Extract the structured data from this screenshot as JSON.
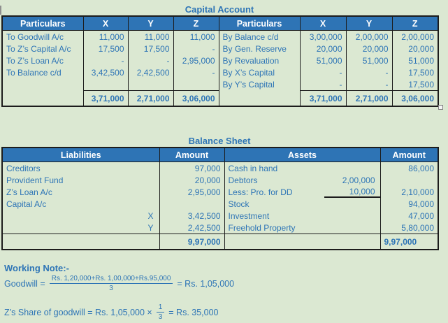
{
  "page": {
    "background_color": "#dbe8d2",
    "accent_color": "#2e75b6",
    "table_header_fill": "#2e74b5",
    "table_header_text_color": "#ffffff",
    "border_color": "#1c1c1c"
  },
  "capital_account": {
    "title": "Capital Account",
    "headers": [
      "Particulars",
      "X",
      "Y",
      "Z",
      "Particulars",
      "X",
      "Y",
      "Z"
    ],
    "rows": [
      [
        "To Goodwill A/c",
        "11,000",
        "11,000",
        "11,000",
        "By Balance c/d",
        "3,00,000",
        "2,00,000",
        "2,00,000"
      ],
      [
        "To Z’s Capital A/c",
        "17,500",
        "17,500",
        "-",
        "By Gen. Reserve",
        "20,000",
        "20,000",
        "20,000"
      ],
      [
        "To Z’s Loan A/c",
        "-",
        "-",
        "2,95,000",
        "By Revaluation",
        "51,000",
        "51,000",
        "51,000"
      ],
      [
        "To Balance c/d",
        "3,42,500",
        "2,42,500",
        "-",
        "By X’s Capital",
        "-",
        "-",
        "17,500"
      ],
      [
        "",
        "",
        "",
        "",
        "By Y’s Capital",
        "-",
        "-",
        "17,500"
      ]
    ],
    "totals": [
      "",
      "3,71,000",
      "2,71,000",
      "3,06,000",
      "",
      "3,71,000",
      "2,71,000",
      "3,06,000"
    ]
  },
  "balance_sheet": {
    "title": "Balance Sheet",
    "headers": [
      "Liabilities",
      "Amount",
      "Assets",
      "Amount"
    ],
    "liability_rows": [
      {
        "label": "Creditors",
        "amount": "97,000"
      },
      {
        "label": "Provident Fund",
        "amount": "20,000"
      },
      {
        "label": "Z’s Loan A/c",
        "amount": "2,95,000"
      },
      {
        "label": "Capital A/c",
        "amount": ""
      },
      {
        "label": "X",
        "amount": "3,42,500"
      },
      {
        "label": "Y",
        "amount": "2,42,500"
      }
    ],
    "asset_rows": [
      {
        "label": "Cash in hand",
        "sub": "",
        "amount": "86,000"
      },
      {
        "label": "Debtors",
        "sub": "2,00,000",
        "amount": ""
      },
      {
        "label": "Less: Pro. for DD",
        "sub": "10,000",
        "amount": "2,10,000"
      },
      {
        "label": "Stock",
        "sub": "",
        "amount": "94,000"
      },
      {
        "label": "Investment",
        "sub": "",
        "amount": "47,000"
      },
      {
        "label": "Freehold Property",
        "sub": "",
        "amount": "5,80,000"
      }
    ],
    "total_left": "9,97,000",
    "total_right": "9,97,000"
  },
  "working_note": {
    "heading": "Working Note:-",
    "goodwill_prefix": "Goodwill =",
    "goodwill_numerator": "Rs. 1,20,000+Rs. 1,00,000+Rs.95,000",
    "goodwill_denominator": "3",
    "goodwill_result": "= Rs. 1,05,000",
    "z_share_prefix": "Z’s Share of goodwill = Rs. 1,05,000 ×",
    "z_share_fraction_num": "1",
    "z_share_fraction_den": "3",
    "z_share_result": "= Rs. 35,000"
  }
}
